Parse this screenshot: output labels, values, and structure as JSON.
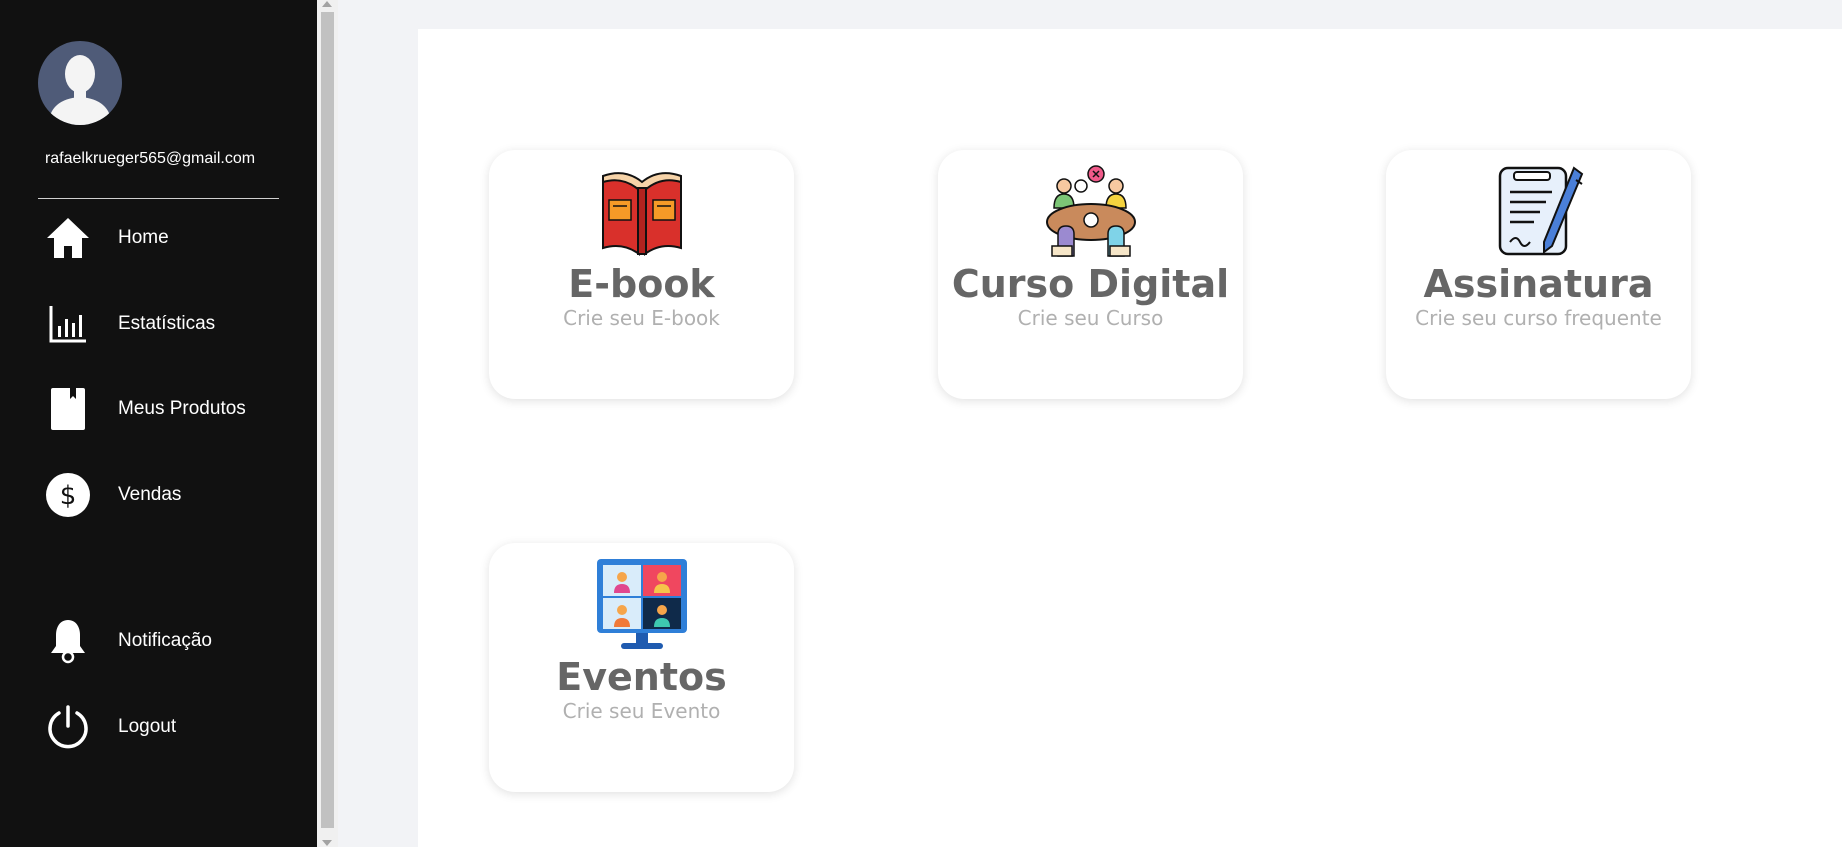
{
  "user": {
    "email": "rafaelkrueger565@gmail.com"
  },
  "nav": {
    "items": [
      {
        "label": "Home",
        "icon": "home-icon"
      },
      {
        "label": "Estatísticas",
        "icon": "bar-chart-icon"
      },
      {
        "label": "Meus Produtos",
        "icon": "book-icon"
      },
      {
        "label": "Vendas",
        "icon": "dollar-icon"
      },
      {
        "label": "Notificação",
        "icon": "bell-icon"
      },
      {
        "label": "Logout",
        "icon": "power-icon"
      }
    ]
  },
  "cards": [
    {
      "title": "E-book",
      "subtitle": "Crie seu E-book",
      "icon": "open-book-icon"
    },
    {
      "title": "Curso Digital",
      "subtitle": "Crie seu Curso",
      "icon": "group-meeting-icon"
    },
    {
      "title": "Assinatura",
      "subtitle": "Crie seu curso frequente",
      "icon": "signature-contract-icon"
    },
    {
      "title": "Eventos",
      "subtitle": "Crie seu Evento",
      "icon": "video-conference-icon"
    }
  ],
  "colors": {
    "sidebar": "#111111",
    "card_title": "#666666",
    "card_subtitle": "#b0b0b0",
    "background": "#f2f3f6"
  }
}
